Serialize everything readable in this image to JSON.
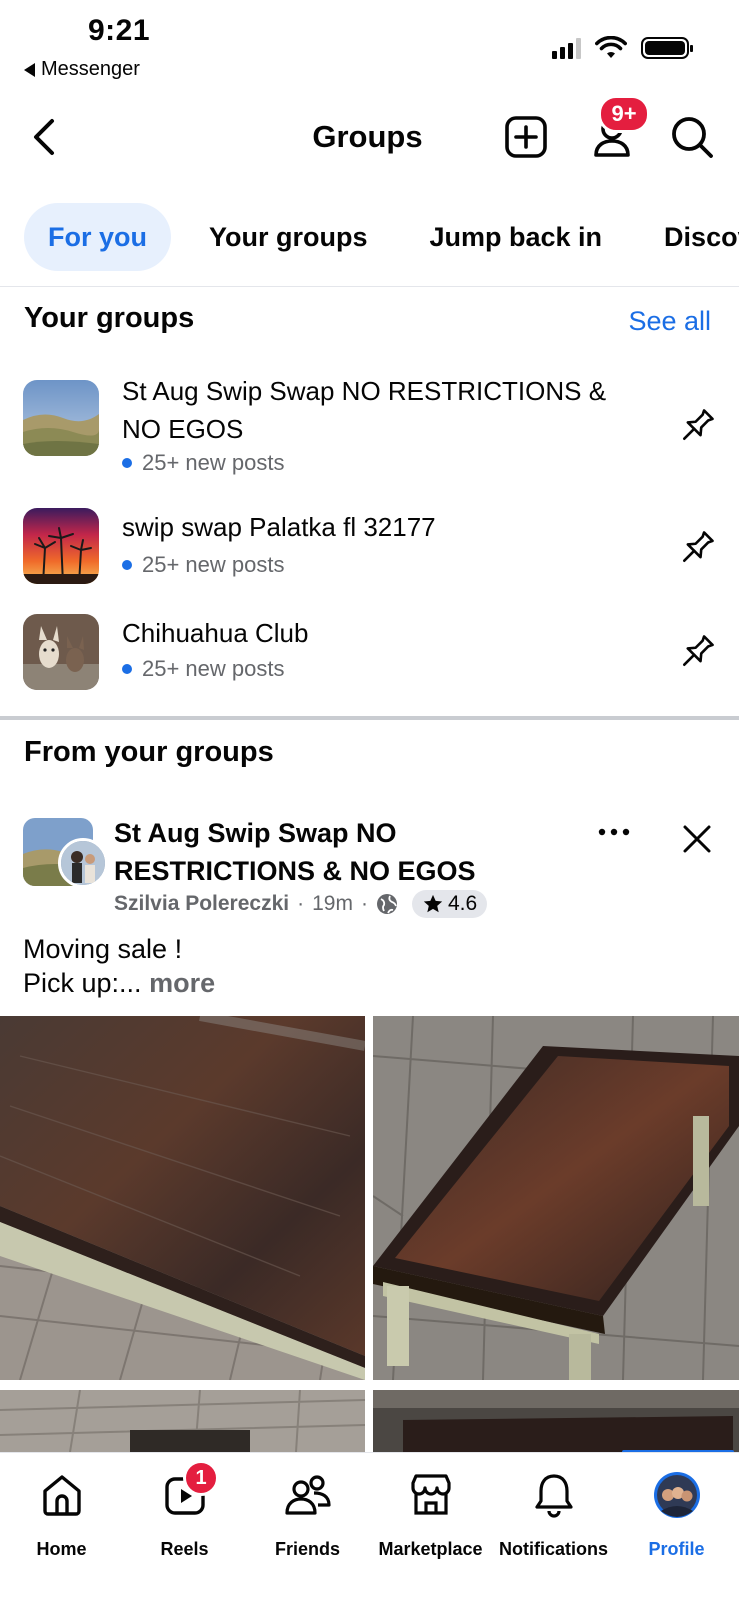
{
  "status_bar": {
    "time": "9:21",
    "back_app": "Messenger"
  },
  "header": {
    "title": "Groups",
    "notification_badge": "9+",
    "icons": {
      "back": "chevron-left-icon",
      "create": "plus-square-icon",
      "people": "person-icon",
      "search": "search-icon"
    }
  },
  "tabs": [
    {
      "label": "For you",
      "active": true
    },
    {
      "label": "Your groups",
      "active": false
    },
    {
      "label": "Jump back in",
      "active": false
    },
    {
      "label": "Discover",
      "active": false
    }
  ],
  "your_groups": {
    "title": "Your groups",
    "see_all": "See all",
    "items": [
      {
        "name": "St Aug Swip Swap NO RESTRICTIONS & NO EGOS",
        "meta": "25+ new posts"
      },
      {
        "name": "swip swap Palatka fl 32177",
        "meta": "25+ new posts"
      },
      {
        "name": "Chihuahua Club",
        "meta": "25+ new posts"
      }
    ]
  },
  "feed": {
    "title": "From your groups",
    "post": {
      "group_name": "St Aug Swip Swap NO RESTRICTIONS & NO EGOS",
      "author": "Szilvia Polereczki",
      "time": "19m",
      "rating": "4.6",
      "text_line1": "Moving sale !",
      "text_line2": "Pick up:...",
      "more_label": "more"
    }
  },
  "bottom_nav": {
    "items": [
      {
        "label": "Home",
        "icon": "home-icon"
      },
      {
        "label": "Reels",
        "icon": "reels-icon",
        "badge": "1"
      },
      {
        "label": "Friends",
        "icon": "friends-icon"
      },
      {
        "label": "Marketplace",
        "icon": "marketplace-icon"
      },
      {
        "label": "Notifications",
        "icon": "bell-icon"
      },
      {
        "label": "Profile",
        "icon": "profile-avatar",
        "active": true
      }
    ]
  },
  "colors": {
    "accent": "#1b6ee5",
    "badge": "#e41e3f",
    "tab_active_bg": "#e7f0fd",
    "secondary_text": "#65676b"
  }
}
